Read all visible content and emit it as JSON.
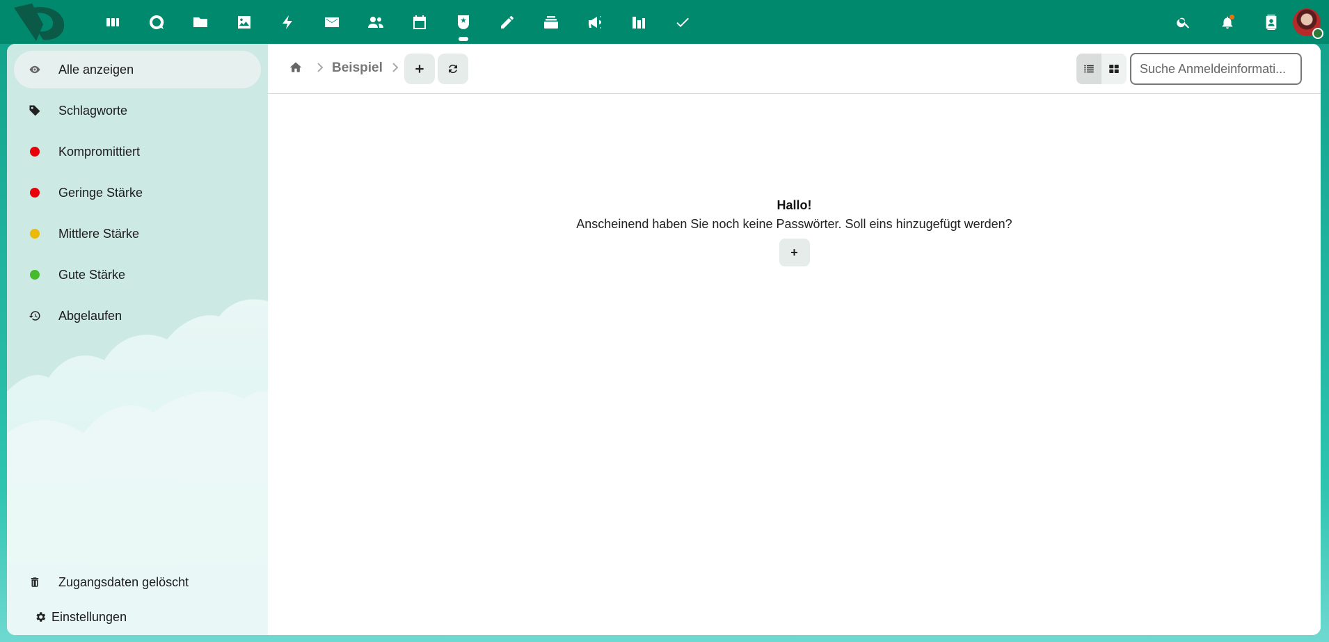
{
  "header": {
    "apps": [
      {
        "icon": "dashboard-icon",
        "name": "app-dashboard"
      },
      {
        "icon": "talk-icon",
        "name": "app-talk"
      },
      {
        "icon": "folder-icon",
        "name": "app-files"
      },
      {
        "icon": "image-icon",
        "name": "app-photos"
      },
      {
        "icon": "lightning-icon",
        "name": "app-activity"
      },
      {
        "icon": "mail-icon",
        "name": "app-mail"
      },
      {
        "icon": "contacts-icon",
        "name": "app-contacts"
      },
      {
        "icon": "calendar-icon",
        "name": "app-calendar"
      },
      {
        "icon": "passwords-icon",
        "name": "app-passwords"
      },
      {
        "icon": "pencil-icon",
        "name": "app-notes"
      },
      {
        "icon": "deck-icon",
        "name": "app-deck"
      },
      {
        "icon": "announcement-icon",
        "name": "app-announcements"
      },
      {
        "icon": "chart-icon",
        "name": "app-analytics"
      },
      {
        "icon": "check-icon",
        "name": "app-tasks"
      }
    ],
    "active_app": "app-passwords"
  },
  "sidebar": {
    "items": [
      {
        "label": "Alle anzeigen",
        "icon": "eye-icon",
        "active": true
      },
      {
        "label": "Schlagworte",
        "icon": "tag-icon"
      },
      {
        "label": "Kompromittiert",
        "icon": "dot",
        "color": "#e8000b"
      },
      {
        "label": "Geringe Stärke",
        "icon": "dot",
        "color": "#e8000b"
      },
      {
        "label": "Mittlere Stärke",
        "icon": "dot",
        "color": "#ecb90a"
      },
      {
        "label": "Gute Stärke",
        "icon": "dot",
        "color": "#46ba2d"
      },
      {
        "label": "Abgelaufen",
        "icon": "history-icon"
      }
    ],
    "trash_label": "Zugangsdaten gelöscht",
    "settings_label": "Einstellungen"
  },
  "toolbar": {
    "breadcrumb_label": "Beispiel",
    "search_placeholder": "Suche Anmeldeinformati..."
  },
  "empty_state": {
    "title": "Hallo!",
    "text": "Anscheinend haben Sie noch keine Passwörter. Soll eins hinzugefügt werden?",
    "add_label": "+"
  },
  "colors": {
    "header_bg": "#00896d",
    "sidebar_bg": "#cde9e3"
  }
}
